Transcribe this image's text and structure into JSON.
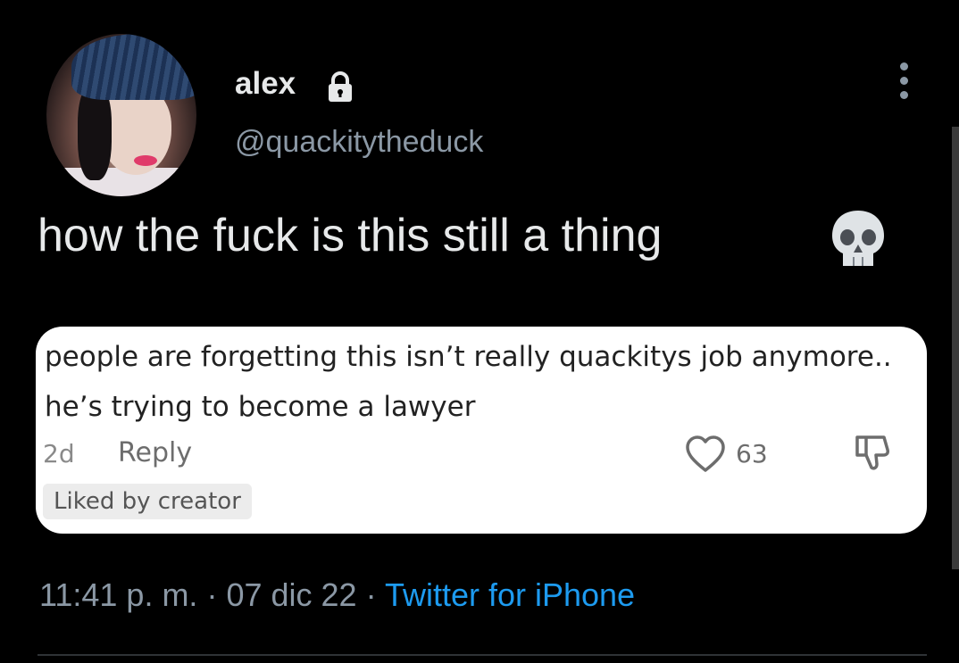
{
  "author": {
    "name": "alex",
    "handle": "@quackitytheduck",
    "protected_icon": "lock-icon"
  },
  "tweet": {
    "text": "how the fuck is this still a thing",
    "emoji": "skull-icon"
  },
  "quoted_comment": {
    "text": "people are forgetting this isn’t really quackitys job anymore.. he’s trying to become a lawyer",
    "age": "2d",
    "reply_label": "Reply",
    "like_count": "63",
    "badge": "Liked by creator"
  },
  "meta": {
    "time": "11:41 p. m.",
    "separator": "·",
    "date": "07 dic 22",
    "source": "Twitter for iPhone"
  },
  "colors": {
    "background": "#000000",
    "primary_text": "#e7e9ea",
    "secondary_text": "#8b98a5",
    "link": "#1d9bf0"
  }
}
